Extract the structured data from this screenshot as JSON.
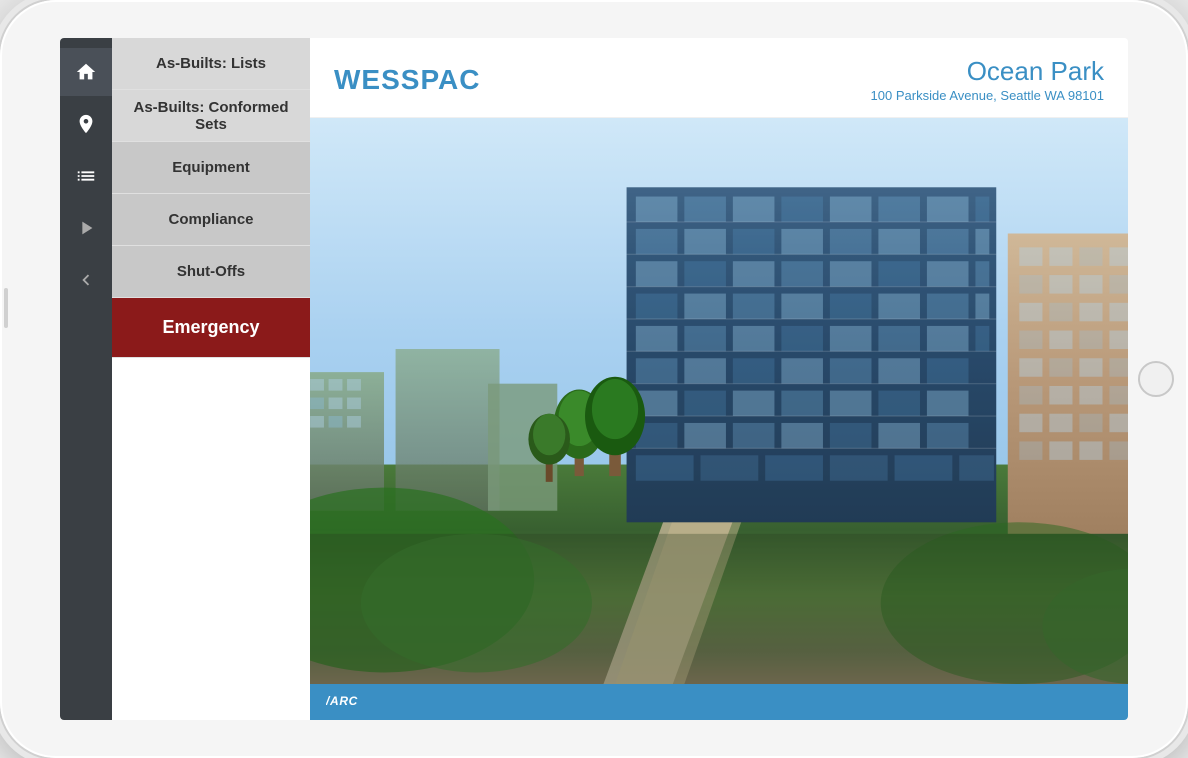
{
  "app": {
    "brand": "WESSPAC"
  },
  "property": {
    "name": "Ocean Park",
    "address": "100 Parkside Avenue, Seattle WA 98101"
  },
  "sidebar_icons": [
    {
      "id": "home",
      "label": "Home",
      "active": true
    },
    {
      "id": "location",
      "label": "Location"
    },
    {
      "id": "list",
      "label": "List"
    },
    {
      "id": "play",
      "label": "Play"
    },
    {
      "id": "back",
      "label": "Back"
    }
  ],
  "menu_items": [
    {
      "id": "as-builts-lists",
      "label": "As-Builts: Lists",
      "style": "light"
    },
    {
      "id": "as-builts-conformed",
      "label": "As-Builts: Conformed Sets",
      "style": "light"
    },
    {
      "id": "equipment",
      "label": "Equipment",
      "style": "medium"
    },
    {
      "id": "compliance",
      "label": "Compliance",
      "style": "medium"
    },
    {
      "id": "shut-offs",
      "label": "Shut-Offs",
      "style": "medium"
    },
    {
      "id": "emergency",
      "label": "Emergency",
      "style": "emergency"
    }
  ],
  "footer": {
    "logo": "ARC"
  },
  "colors": {
    "brand_blue": "#3a8fc4",
    "sidebar_dark": "#3a3f44",
    "emergency_red": "#8b1a1a",
    "footer_blue": "#3a8fc4"
  }
}
